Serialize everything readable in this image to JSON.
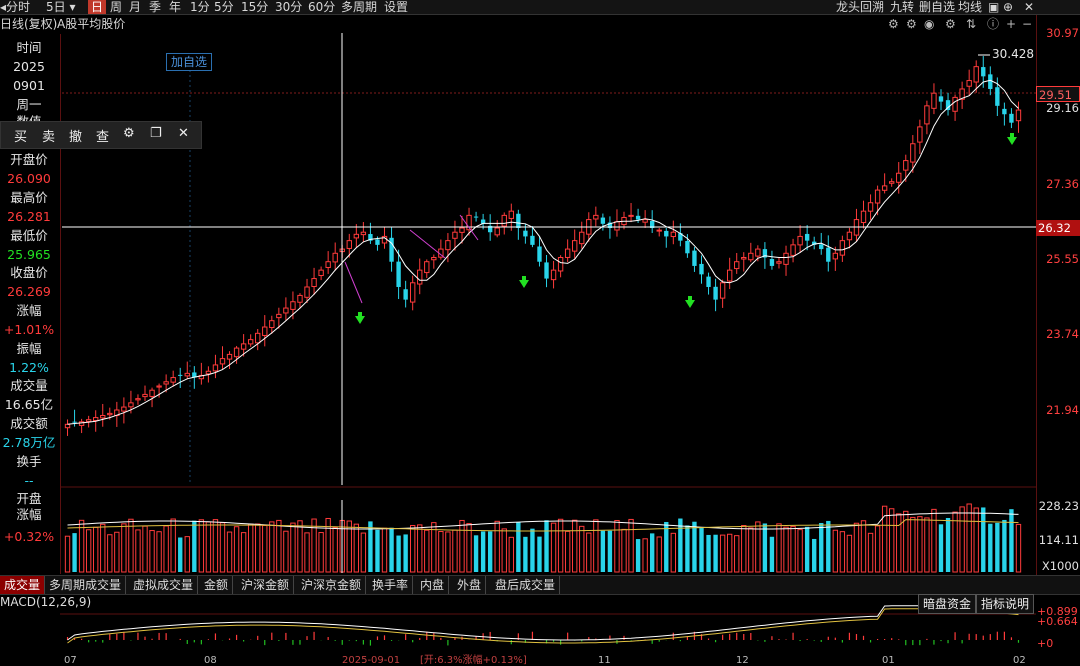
{
  "topbar": {
    "periods": [
      "分时",
      "5日",
      "日",
      "周",
      "月",
      "季",
      "年",
      "1分",
      "5分",
      "15分",
      "30分",
      "60分",
      "多周期",
      "设置"
    ],
    "active_period": "日",
    "right_buttons": [
      "龙头回溯",
      "九转",
      "删自选",
      "均线"
    ]
  },
  "subbar": {
    "chart_type": "日线(复权)",
    "indicator": "A股平均股价"
  },
  "add_watch_label": "加自选",
  "trade_toolbar": [
    "买",
    "卖",
    "撤",
    "查"
  ],
  "info_panel": {
    "time_label": "时间",
    "year": "2025",
    "date": "0901",
    "weekday": "周一",
    "value_label": "数值",
    "open_label": "开盘价",
    "open": "26.090",
    "high_label": "最高价",
    "high": "26.281",
    "low_label": "最低价",
    "low": "25.965",
    "close_label": "收盘价",
    "close": "26.269",
    "change_label": "涨幅",
    "change": "+1.01%",
    "amplitude_label": "振幅",
    "amplitude": "1.22%",
    "volume_label": "成交量",
    "volume": "16.65亿",
    "amount_label": "成交额",
    "amount": "2.78万亿",
    "turnover_label": "换手",
    "turnover": "--",
    "open_change_label": "开盘\n涨幅",
    "open_change": "+0.32%"
  },
  "price_axis": {
    "ticks": [
      "30.97",
      "29.51",
      "29.16",
      "27.36",
      "26.32",
      "25.55",
      "23.74",
      "21.94"
    ],
    "crosshair_value": "26.32",
    "last_value": "29.51",
    "peak_label": "30.428"
  },
  "volume_axis": {
    "ticks": [
      "228.23",
      "114.11"
    ],
    "unit": "X1000"
  },
  "bottom_tabs": [
    "成交量",
    "多周期成交量",
    "虚拟成交量",
    "金额",
    "沪深金额",
    "沪深京金额",
    "换手率",
    "内盘",
    "外盘",
    "盘后成交量"
  ],
  "active_tab": "成交量",
  "macd": {
    "title": "MACD(12,26,9)",
    "buttons": [
      "暗盘资金",
      "指标说明"
    ],
    "ticks": [
      "+0.899",
      "+0.664",
      "+0"
    ]
  },
  "date_axis": {
    "labels": [
      "07",
      "08",
      "2025-09-01",
      "11",
      "12",
      "01",
      "02"
    ],
    "crosshair_info": "[开:6.3%涨幅+0.13%]"
  },
  "colors": {
    "up": "#ff3b3b",
    "down": "#29d4ea",
    "ma": "#ffffff",
    "crosshair": "#ffffff",
    "arrow": "#22e022"
  },
  "chart_data": {
    "type": "candlestick",
    "y_range": [
      20.5,
      31.3
    ],
    "closes": [
      21.94,
      21.98,
      22.0,
      22.05,
      22.1,
      22.15,
      22.2,
      22.28,
      22.35,
      22.45,
      22.55,
      22.65,
      22.75,
      22.85,
      22.95,
      23.05,
      23.1,
      23.15,
      23.05,
      23.1,
      23.2,
      23.35,
      23.5,
      23.6,
      23.75,
      23.85,
      23.95,
      24.1,
      24.25,
      24.4,
      24.55,
      24.7,
      24.85,
      25.0,
      25.2,
      25.4,
      25.6,
      25.8,
      26.0,
      26.1,
      26.3,
      26.45,
      26.5,
      26.3,
      26.2,
      26.4,
      25.8,
      25.2,
      24.9,
      25.3,
      25.6,
      25.8,
      25.9,
      26.1,
      26.3,
      26.5,
      26.6,
      26.9,
      26.85,
      26.7,
      26.5,
      26.6,
      26.9,
      27.0,
      26.6,
      26.4,
      26.2,
      25.8,
      25.4,
      25.6,
      25.9,
      26.1,
      26.3,
      26.5,
      26.8,
      26.9,
      26.7,
      26.6,
      26.75,
      26.85,
      26.9,
      26.8,
      26.8,
      26.6,
      26.55,
      26.4,
      26.5,
      26.3,
      26.0,
      25.7,
      25.5,
      25.2,
      24.9,
      25.3,
      25.6,
      25.8,
      25.9,
      26.0,
      26.1,
      25.9,
      25.7,
      25.8,
      26.0,
      26.2,
      26.4,
      26.3,
      26.2,
      26.1,
      25.8,
      26.0,
      26.3,
      26.5,
      26.8,
      27.0,
      27.2,
      27.5,
      27.6,
      27.7,
      27.9,
      28.2,
      28.6,
      29.0,
      29.5,
      29.8,
      29.6,
      29.4,
      29.7,
      29.9,
      30.1,
      30.43,
      30.2,
      29.9,
      29.5,
      29.3,
      29.1,
      29.4
    ]
  }
}
